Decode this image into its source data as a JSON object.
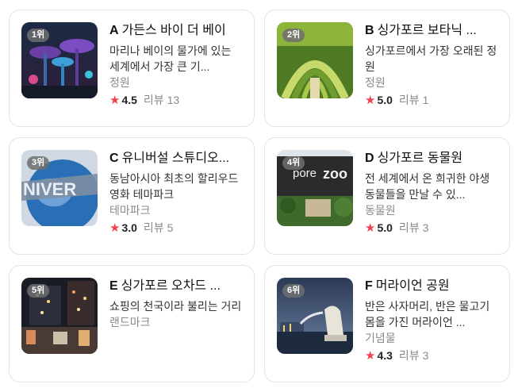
{
  "cards": [
    {
      "rank": "1위",
      "letter": "A",
      "name": "가든스 바이 더 베이",
      "desc": "마리나 베이의 물가에 있는 세계에서 가장 큰 기...",
      "category": "정원",
      "rating": "4.5",
      "review_label": "리뷰",
      "review_count": "13",
      "image": "gardens-by-the-bay-photo"
    },
    {
      "rank": "2위",
      "letter": "B",
      "name": "싱가포르 보타닉 ...",
      "desc": "싱가포르에서 가장 오래된 정원",
      "category": "정원",
      "rating": "5.0",
      "review_label": "리뷰",
      "review_count": "1",
      "image": "botanic-garden-photo"
    },
    {
      "rank": "3위",
      "letter": "C",
      "name": "유니버설 스튜디오...",
      "desc": "동남아시아 최초의 할리우드 영화 테마파크",
      "category": "테마파크",
      "rating": "3.0",
      "review_label": "리뷰",
      "review_count": "5",
      "image": "universal-globe-photo"
    },
    {
      "rank": "4위",
      "letter": "D",
      "name": "싱가포르 동물원",
      "desc": "전 세계에서 온 희귀한 야생 동물들을 만날 수 있...",
      "category": "동물원",
      "rating": "5.0",
      "review_label": "리뷰",
      "review_count": "3",
      "image": "singapore-zoo-photo"
    },
    {
      "rank": "5위",
      "letter": "E",
      "name": "싱가포르 오차드 ...",
      "desc": "쇼핑의 천국이라 불리는 거리",
      "category": "랜드마크",
      "rating": null,
      "review_label": null,
      "review_count": null,
      "image": "orchard-road-photo"
    },
    {
      "rank": "6위",
      "letter": "F",
      "name": "머라이언 공원",
      "desc": "반은 사자머리, 반은 물고기 몸을 가진 머라이언 ...",
      "category": "기념물",
      "rating": "4.3",
      "review_label": "리뷰",
      "review_count": "3",
      "image": "merlion-park-photo"
    }
  ],
  "colors": {
    "star": "#f0434d",
    "border": "#e3e3e3",
    "muted": "#8a8a8a"
  },
  "icons": {
    "rating": "star-icon"
  }
}
